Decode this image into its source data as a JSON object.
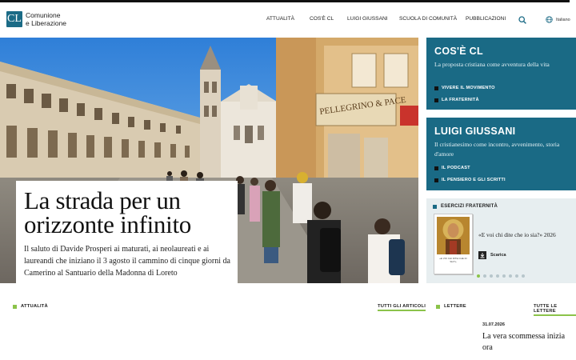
{
  "header": {
    "logo_mark": "CL",
    "logo_line1": "Comunione",
    "logo_line2": "e Liberazione",
    "nav": [
      "ATTUALITÀ",
      "COS'È CL",
      "LUIGI GIUSSANI",
      "SCUOLA DI COMUNITÀ",
      "PUBBLICAZIONI"
    ],
    "language": "Italiano"
  },
  "hero": {
    "title": "La strada per un orizzonte infinito",
    "subtitle": "Il saluto di Davide Prosperi ai maturati, ai neolaureati e ai laureandi che iniziano il 3 agosto il cammino di cinque giorni da Camerino al Santuario della Madonna di Loreto",
    "sign_text": "PELLEGRINO & PACE"
  },
  "panels": {
    "cos_e_cl": {
      "title": "COS'È CL",
      "desc": "La proposta cristiana come avventura della vita",
      "links": [
        "VIVERE IL MOVIMENTO",
        "LA FRATERNITÀ"
      ]
    },
    "giussani": {
      "title": "LUIGI GIUSSANI",
      "desc": "Il cristianesimo come incontro, avvenimento, storia d'amore",
      "links": [
        "IL PODCAST",
        "IL PENSIERO E GLI SCRITTI"
      ]
    },
    "esercizi": {
      "title": "ESERCIZI FRATERNITÀ",
      "book_caption": "«E VOI CHI DITE CHE IO SIA?»",
      "quote": "«E voi chi dite che io sia?» 2026",
      "download": "Scarica",
      "slides": 8,
      "active_slide": 0
    }
  },
  "sections": {
    "attualita_label": "ATTUALITÀ",
    "attualita_link": "TUTTI GLI ARTICOLI",
    "lettere_label": "LETTERE",
    "lettere_link": "TUTTE LE LETTERE",
    "letter_date": "31.07.2026",
    "letter_title": "La vera scommessa inizia ora"
  },
  "colors": {
    "brand_teal": "#1a6a85",
    "accent_green": "#8bc34a"
  }
}
